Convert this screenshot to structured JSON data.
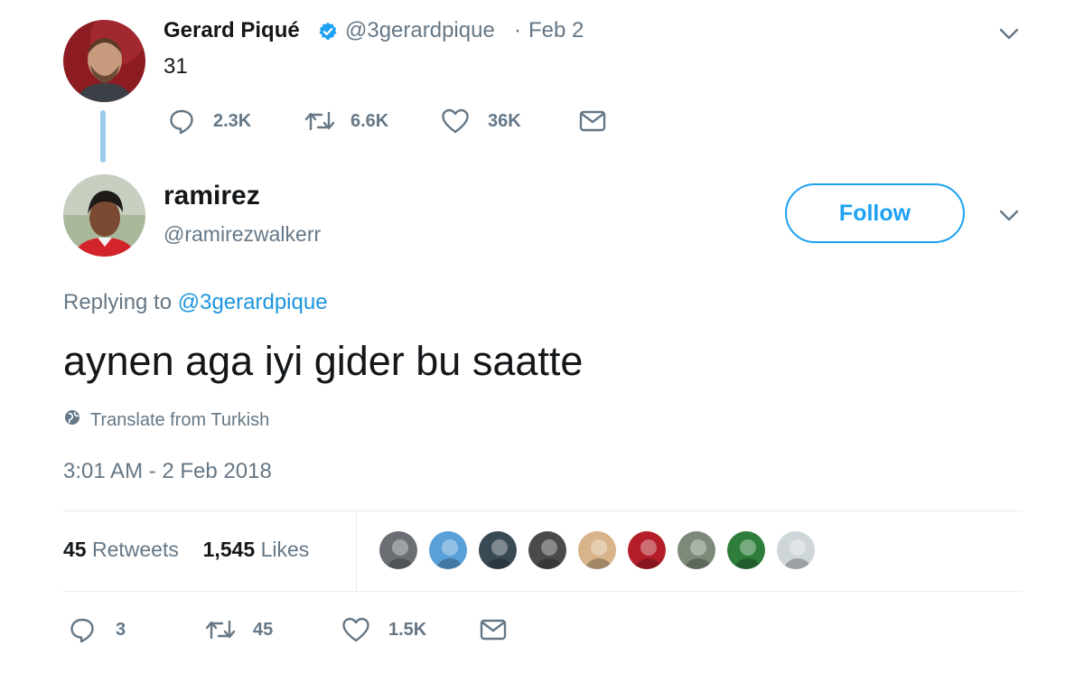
{
  "parent_tweet": {
    "author_name": "Gerard Piqué",
    "handle": "@3gerardpique",
    "separator": "·",
    "date": "Feb 2",
    "text": "31",
    "actions": {
      "replies": "2.3K",
      "retweets": "6.6K",
      "likes": "36K"
    }
  },
  "reply_tweet": {
    "author_name": "ramirez",
    "handle": "@ramirezwalkerr",
    "follow_label": "Follow",
    "replying_prefix": "Replying to",
    "replying_to": "@3gerardpique",
    "text": "aynen aga iyi gider bu saatte",
    "translate_label": "Translate from Turkish",
    "timestamp": "3:01 AM - 2 Feb 2018",
    "stats": {
      "retweet_count": "45",
      "retweet_label": "Retweets",
      "like_count": "1,545",
      "like_label": "Likes"
    },
    "actions": {
      "replies": "3",
      "retweets": "45",
      "likes": "1.5K"
    }
  },
  "likers": [
    {
      "color": "#6b6f74"
    },
    {
      "color": "#5aa0d8"
    },
    {
      "color": "#3a4a55"
    },
    {
      "color": "#4a4a4a"
    },
    {
      "color": "#d9b48a"
    },
    {
      "color": "#b41e28"
    },
    {
      "color": "#7d8a7a"
    },
    {
      "color": "#2e7d3a"
    },
    {
      "color": "#cfd6da"
    }
  ],
  "colors": {
    "accent": "#1da1f2",
    "link": "#1b95e0",
    "muted": "#657786",
    "text": "#14171a",
    "thread_line": "#9ccaeb"
  }
}
